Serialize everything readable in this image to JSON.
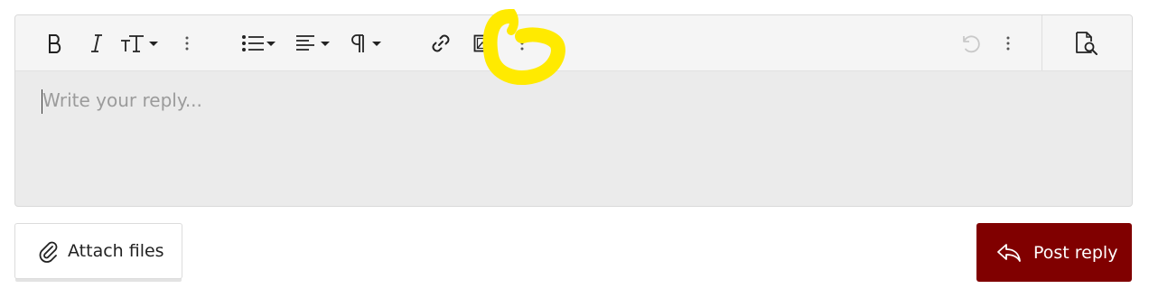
{
  "editor": {
    "placeholder": "Write your reply...",
    "toolbar": [
      {
        "name": "bold-icon"
      },
      {
        "name": "italic-icon"
      },
      {
        "name": "font-size-icon"
      },
      {
        "name": "more-text-options-icon"
      },
      {
        "name": "list-icon"
      },
      {
        "name": "align-icon"
      },
      {
        "name": "paragraph-icon"
      },
      {
        "name": "link-icon"
      },
      {
        "name": "image-icon"
      },
      {
        "name": "more-insert-options-icon"
      },
      {
        "name": "undo-icon"
      },
      {
        "name": "more-options-icon"
      },
      {
        "name": "preview-icon"
      }
    ]
  },
  "actions": {
    "attach_label": "Attach files",
    "post_label": "Post reply"
  },
  "colors": {
    "post_button": "#800000",
    "annotation_highlight": "#ffea00"
  }
}
